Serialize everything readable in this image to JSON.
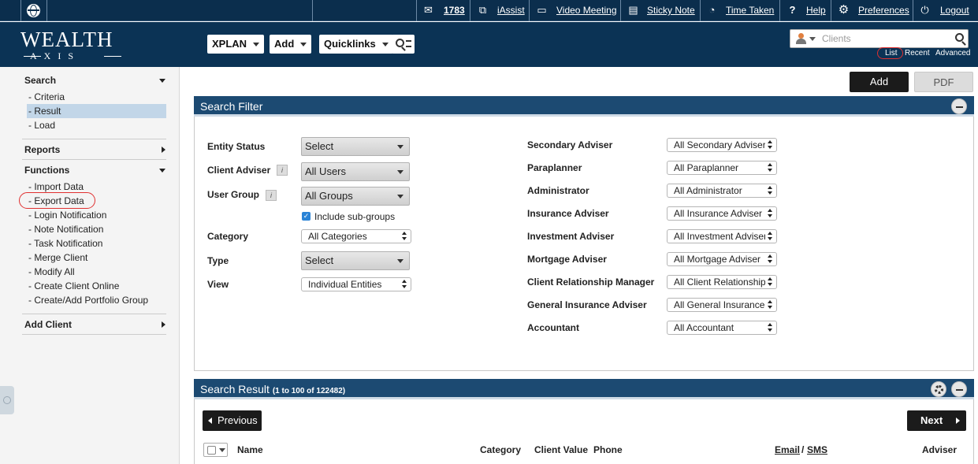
{
  "topbar": {
    "count": "1783",
    "iassist": "iAssist",
    "video_meeting": "Video Meeting",
    "sticky_note": "Sticky Note",
    "time_taken": "Time Taken",
    "help_glyph": "?",
    "help": "Help",
    "preferences": "Preferences",
    "logout": "Logout"
  },
  "header": {
    "logo_top": "WEALTH",
    "logo_bottom": "AXIS",
    "nav": [
      "XPLAN",
      "Add",
      "Quicklinks"
    ],
    "search_placeholder": "Clients",
    "links": [
      "List",
      "Recent",
      "Advanced"
    ]
  },
  "sidebar": {
    "search": {
      "title": "Search",
      "items": [
        "- Criteria",
        "- Result",
        "- Load"
      ],
      "selected": "- Result"
    },
    "reports": "Reports",
    "functions": {
      "title": "Functions",
      "items": [
        "- Import Data",
        "- Export Data",
        "- Login Notification",
        "- Note Notification",
        "- Task Notification",
        "- Merge Client",
        "- Modify All",
        "- Create Client Online",
        "- Create/Add Portfolio Group"
      ]
    },
    "add_client": "Add Client"
  },
  "actions": {
    "add": "Add",
    "pdf": "PDF"
  },
  "search_filter": {
    "title": "Search Filter",
    "left": [
      {
        "label": "Entity Status",
        "value": "Select"
      },
      {
        "label": "Client Adviser",
        "value": "All Users"
      },
      {
        "label": "User Group",
        "value": "All Groups"
      },
      {
        "label": "Category",
        "value": "All Categories"
      },
      {
        "label": "Type",
        "value": "Select"
      },
      {
        "label": "View",
        "value": "Individual Entities"
      }
    ],
    "include_subgroups": "Include sub-groups",
    "right": [
      {
        "label": "Secondary Adviser",
        "value": "All Secondary Adviser"
      },
      {
        "label": "Paraplanner",
        "value": "All Paraplanner"
      },
      {
        "label": "Administrator",
        "value": "All Administrator"
      },
      {
        "label": "Insurance Adviser",
        "value": "All Insurance Adviser"
      },
      {
        "label": "Investment Adviser",
        "value": "All Investment Adviser"
      },
      {
        "label": "Mortgage Adviser",
        "value": "All Mortgage Adviser"
      },
      {
        "label": "Client Relationship Manager",
        "value": "All Client Relationship Manager"
      },
      {
        "label": "General Insurance Adviser",
        "value": "All General Insurance Adviser"
      },
      {
        "label": "Accountant",
        "value": "All Accountant"
      }
    ]
  },
  "search_result": {
    "title": "Search Result",
    "range": "(1 to 100 of 122482)",
    "previous": "Previous",
    "next": "Next",
    "columns": [
      "Name",
      "Category",
      "Client Value",
      "Phone",
      "Email",
      "/",
      "SMS",
      "Adviser"
    ]
  },
  "colors": {
    "navy": "#0b3355",
    "panel_header": "#1c4a72",
    "highlight": "#c2d6e8",
    "annotation": "#e03030"
  }
}
